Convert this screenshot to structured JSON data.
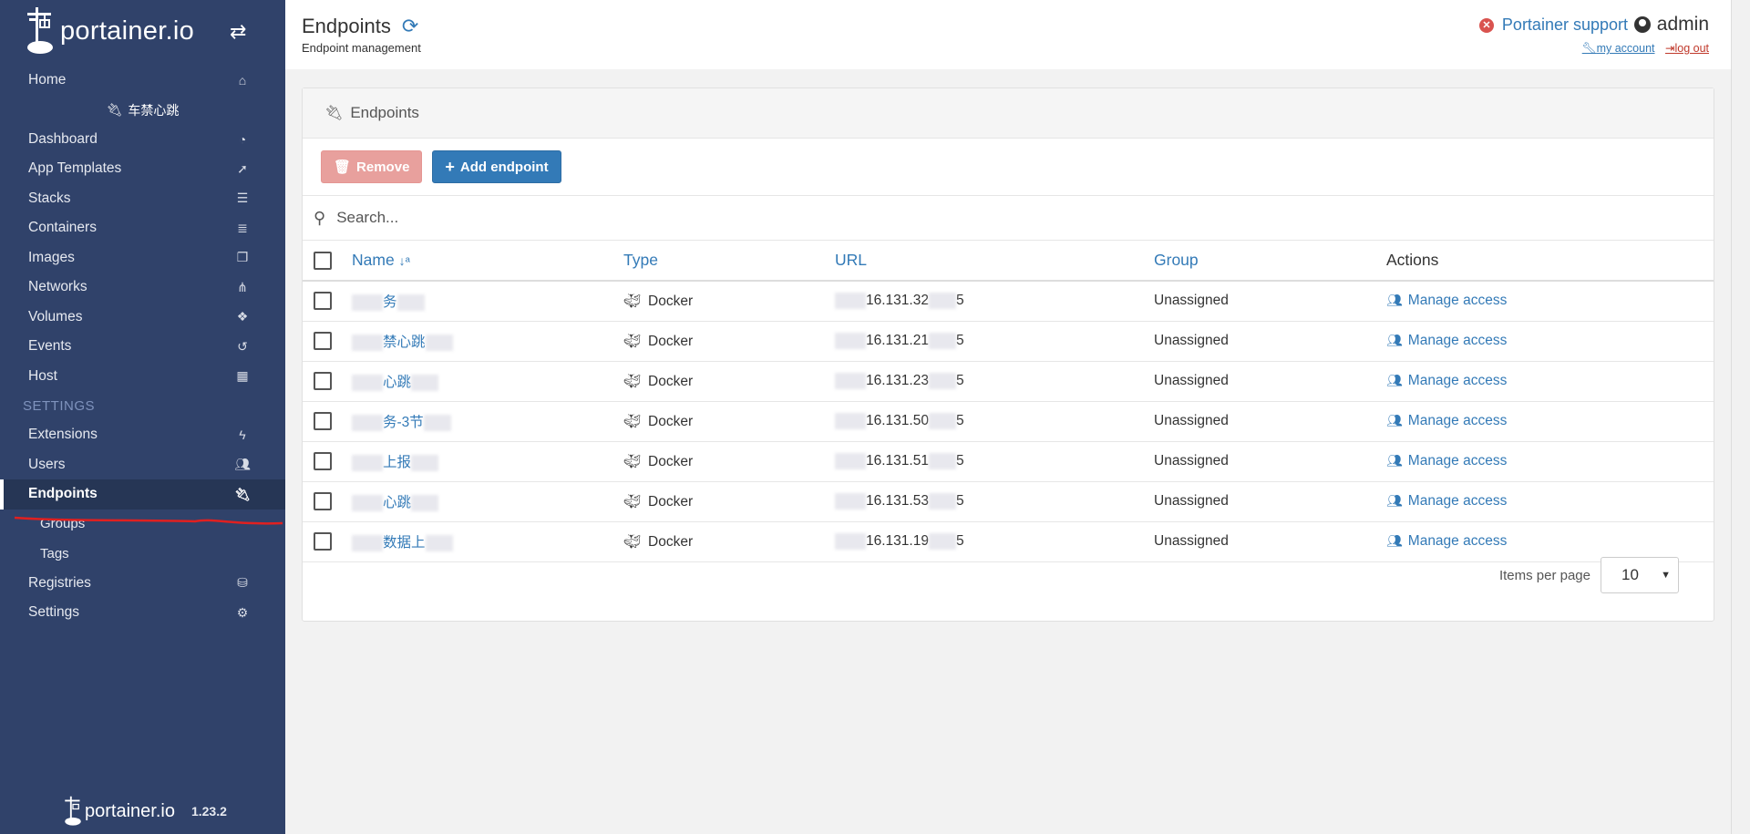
{
  "sidebar": {
    "brand": "portainer.io",
    "endpoint_name": "车禁心跳",
    "items": [
      {
        "label": "Home",
        "icon": "home-icon"
      },
      {
        "label": "Dashboard",
        "icon": "tachometer-icon"
      },
      {
        "label": "App Templates",
        "icon": "rocket-icon"
      },
      {
        "label": "Stacks",
        "icon": "th-list-icon"
      },
      {
        "label": "Containers",
        "icon": "server-icon"
      },
      {
        "label": "Images",
        "icon": "clone-icon"
      },
      {
        "label": "Networks",
        "icon": "sitemap-icon"
      },
      {
        "label": "Volumes",
        "icon": "cubes-icon"
      },
      {
        "label": "Events",
        "icon": "history-icon"
      },
      {
        "label": "Host",
        "icon": "th-icon"
      }
    ],
    "settings_heading": "SETTINGS",
    "settings_items": [
      {
        "label": "Extensions",
        "icon": "bolt-icon"
      },
      {
        "label": "Users",
        "icon": "users-icon"
      },
      {
        "label": "Endpoints",
        "icon": "plug-icon"
      },
      {
        "label": "Groups"
      },
      {
        "label": "Tags"
      },
      {
        "label": "Registries",
        "icon": "database-icon"
      },
      {
        "label": "Settings",
        "icon": "cogs-icon"
      }
    ],
    "footer": {
      "brand": "portainer.io",
      "version": "1.23.2"
    }
  },
  "header": {
    "title": "Endpoints",
    "subtitle": "Endpoint management",
    "support": "Portainer support",
    "user": "admin",
    "my_account": "my account",
    "log_out": "log out"
  },
  "panel": {
    "title": "Endpoints",
    "remove_label": "Remove",
    "add_label": "Add endpoint",
    "search_placeholder": "Search...",
    "columns": {
      "name": "Name",
      "type": "Type",
      "url": "URL",
      "group": "Group",
      "actions": "Actions"
    },
    "rows": [
      {
        "name_visible": "务",
        "type": "Docker",
        "url_visible": "16.131.32",
        "url_tail": "5",
        "group": "Unassigned",
        "action": "Manage access"
      },
      {
        "name_visible": "禁心跳",
        "type": "Docker",
        "url_visible": "16.131.21",
        "url_tail": "5",
        "group": "Unassigned",
        "action": "Manage access"
      },
      {
        "name_visible": "心跳",
        "type": "Docker",
        "url_visible": "16.131.23",
        "url_tail": "5",
        "group": "Unassigned",
        "action": "Manage access"
      },
      {
        "name_visible": "务-3节",
        "type": "Docker",
        "url_visible": "16.131.50",
        "url_tail": "5",
        "group": "Unassigned",
        "action": "Manage access"
      },
      {
        "name_visible": "上报",
        "type": "Docker",
        "url_visible": "16.131.51",
        "url_tail": "5",
        "group": "Unassigned",
        "action": "Manage access"
      },
      {
        "name_visible": "心跳",
        "type": "Docker",
        "url_visible": "16.131.53",
        "url_tail": "5",
        "group": "Unassigned",
        "action": "Manage access"
      },
      {
        "name_visible": "数据上",
        "type": "Docker",
        "url_visible": "16.131.19",
        "url_tail": "5",
        "group": "Unassigned",
        "action": "Manage access"
      }
    ],
    "items_per_page_label": "Items per page",
    "items_per_page_value": "10"
  },
  "colors": {
    "sidebar": "#30426a",
    "accent": "#337ab7",
    "remove": "#e8a09d",
    "annotation": "#e02020"
  }
}
